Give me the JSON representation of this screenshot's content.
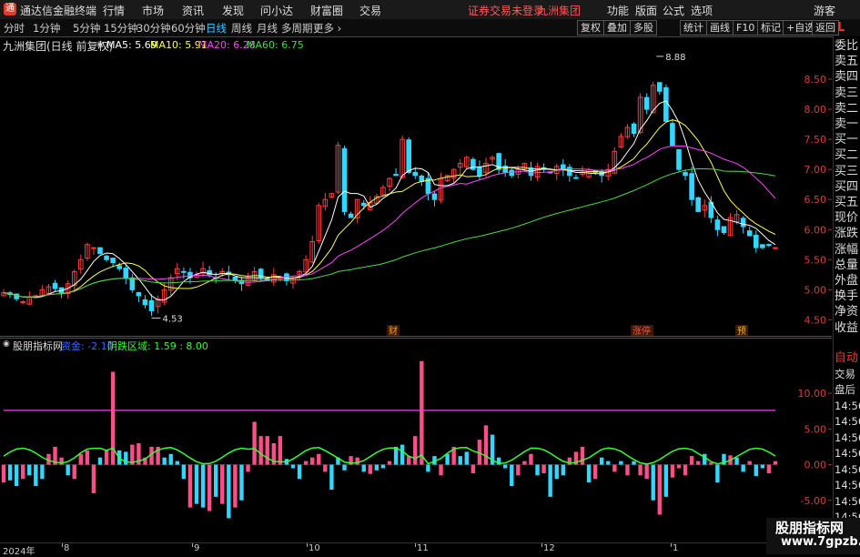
{
  "app": {
    "name": "通达信金融终端",
    "warning": "证券交易未登录",
    "stock": "九洲集团",
    "menus": [
      "行情",
      "市场",
      "资讯",
      "发现",
      "问小达",
      "财富圈",
      "交易"
    ],
    "right_menus": [
      "功能",
      "版面",
      "公式",
      "选项"
    ],
    "guest": "游客"
  },
  "periods": [
    "分时",
    "1分钟",
    "5分钟",
    "15分钟",
    "30分钟",
    "60分钟",
    "日线",
    "周线",
    "月线",
    "多周期",
    "更多 ›"
  ],
  "active_period": "日线",
  "toolbar_buttons": [
    "复权",
    "叠加",
    "多股",
    "统计",
    "画线",
    "F10",
    "标记",
    "+自选",
    "返回"
  ],
  "main_chart": {
    "title": "九洲集团(日线 前复权)",
    "ma_labels": [
      {
        "text": "MA5: 5.69",
        "color": "#ffffff"
      },
      {
        "text": "MA10: 5.91",
        "color": "#ffff44"
      },
      {
        "text": "MA20: 6.28",
        "color": "#ff44ff"
      },
      {
        "text": "MA60: 6.75",
        "color": "#44dd44"
      }
    ],
    "price_ticks": [
      "8.50",
      "8.00",
      "7.50",
      "7.00",
      "6.50",
      "6.00",
      "5.50",
      "5.00",
      "4.50"
    ],
    "high_label": "8.88",
    "low_label": "4.53",
    "markers": [
      "财",
      "涨停",
      "预"
    ]
  },
  "sub_chart": {
    "title": "股朋指标网",
    "legend_1": "资金: -2.10",
    "legend_2": "阴跌区域: 1.59 : 8.00",
    "ticks": [
      "10.00",
      "5.00",
      "0.00",
      "-5.00"
    ]
  },
  "dates": [
    "2024年",
    "8",
    "9",
    "10",
    "11",
    "12",
    "1"
  ],
  "right_panel": {
    "top": "L",
    "items": [
      "委比",
      "卖五",
      "卖四",
      "卖三",
      "卖二",
      "卖一",
      "买一",
      "买二",
      "买三",
      "买四",
      "买五",
      "现价",
      "涨跌",
      "涨幅",
      "总量",
      "外盘",
      "换手",
      "净资",
      "收益"
    ],
    "items2": [
      "自动",
      "交易",
      "盘后",
      "14:56",
      "14:56",
      "14:56",
      "14:56",
      "14:56",
      "14:56",
      "14:56",
      "14:56",
      "14:56"
    ]
  },
  "watermark": {
    "line1": "股朋指标网",
    "line2": "www.7gpzb.com"
  },
  "chart_data": [
    {
      "type": "candlestick",
      "title": "九洲集团(日线 前复权)",
      "ylim": [
        4.4,
        9.0
      ],
      "up_color": "#ff3b3b",
      "down_color": "#30d8ff",
      "closes": [
        4.95,
        4.92,
        4.85,
        4.8,
        4.88,
        4.9,
        5.0,
        5.05,
        5.02,
        4.95,
        5.1,
        5.3,
        5.5,
        5.75,
        5.7,
        5.6,
        5.5,
        5.45,
        5.35,
        5.2,
        5.0,
        4.9,
        4.75,
        4.65,
        4.85,
        5.0,
        5.2,
        5.35,
        5.3,
        5.2,
        5.25,
        5.35,
        5.25,
        5.2,
        5.3,
        5.25,
        5.15,
        5.1,
        5.2,
        5.3,
        5.2,
        5.15,
        5.25,
        5.2,
        5.15,
        5.2,
        5.3,
        5.5,
        5.8,
        6.4,
        6.5,
        6.6,
        7.4,
        6.3,
        6.2,
        6.5,
        6.4,
        6.45,
        6.55,
        6.7,
        6.85,
        6.9,
        7.5,
        6.95,
        6.9,
        6.8,
        6.6,
        6.5,
        6.85,
        6.9,
        7.0,
        7.1,
        7.2,
        7.0,
        6.9,
        7.1,
        7.2,
        7.0,
        6.95,
        6.9,
        7.0,
        7.1,
        6.9,
        7.05,
        7.0,
        6.95,
        7.05,
        7.0,
        6.9,
        6.85,
        6.95,
        7.0,
        6.95,
        6.9,
        7.0,
        7.3,
        7.55,
        7.7,
        7.6,
        8.2,
        8.0,
        8.4,
        8.3,
        7.8,
        7.4,
        7.0,
        6.9,
        6.5,
        6.3,
        6.4,
        6.2,
        6.0,
        5.95,
        6.2,
        6.25,
        6.05,
        5.9,
        5.7,
        5.7,
        5.75,
        5.7
      ],
      "ma": [
        {
          "name": "MA5",
          "value": 5.69
        },
        {
          "name": "MA10",
          "value": 5.91
        },
        {
          "name": "MA20",
          "value": 6.28
        },
        {
          "name": "MA60",
          "value": 6.75
        }
      ],
      "annotations": [
        {
          "text": "8.88",
          "y": 8.88
        },
        {
          "text": "4.53",
          "y": 4.53
        }
      ]
    },
    {
      "type": "bar",
      "title": "股朋指标网",
      "ylim": [
        -10,
        16
      ],
      "reference_line": 7.6,
      "values": [
        -2.5,
        -2.2,
        -3,
        -2,
        -1.5,
        -3,
        -2,
        1.5,
        2.5,
        1,
        -1.5,
        -2,
        1.5,
        2,
        -4,
        1,
        2,
        13,
        2,
        1.8,
        2.8,
        3,
        1,
        2.5,
        2.5,
        1,
        1.5,
        0.5,
        -2,
        -6,
        -5.5,
        -6,
        -6.5,
        -4.5,
        -5.5,
        -7.5,
        -6,
        -5,
        -1,
        6,
        4,
        4,
        3,
        4,
        0.8,
        -0.5,
        -2,
        0.5,
        1,
        1.5,
        -1,
        -3.5,
        1,
        -0.8,
        1.2,
        1,
        -1,
        -1.3,
        -0.8,
        -0.5,
        0.5,
        2.5,
        2.8,
        1.2,
        4,
        14.5,
        -1,
        1.2,
        -1.5,
        1.5,
        2.5,
        1.2,
        1.8,
        -1.2,
        3.5,
        5.5,
        4.2,
        1,
        -0.5,
        -3,
        -1.5,
        0.5,
        1.5,
        -1.5,
        -1.2,
        -4.5,
        -2,
        -1.5,
        1,
        1.8,
        2.5,
        -2.5,
        -2,
        1,
        0.5,
        -1,
        0.5,
        -1.5,
        0.5,
        -1.5,
        -2,
        -5,
        -7,
        -4.5,
        -1.8,
        -0.5,
        -1.5,
        1.2,
        0.5,
        1.5,
        0.3,
        -2.5,
        1.5,
        1.3,
        1,
        -1,
        0.5,
        -1.6,
        -0.5,
        -1.2,
        0.5
      ],
      "line_series": "资金 oscillation"
    }
  ]
}
